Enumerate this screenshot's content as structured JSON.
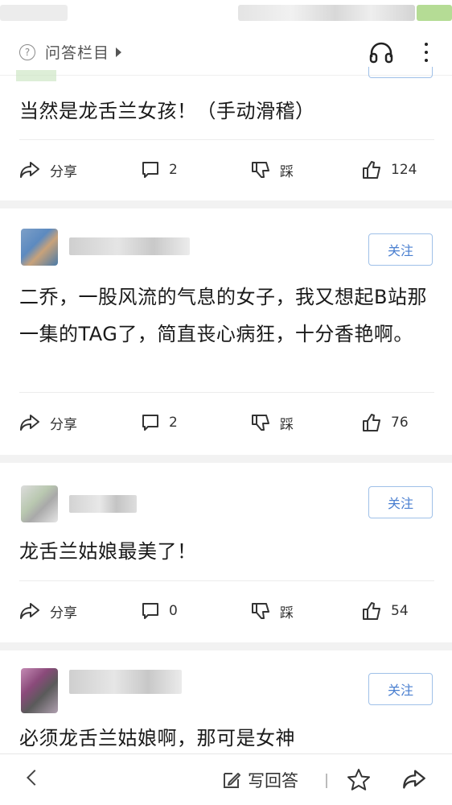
{
  "header": {
    "help_icon": "question-circle-icon",
    "title": "问答栏目",
    "headphone_icon": "headphone-icon",
    "more_icon": "more-vertical-icon"
  },
  "answers": [
    {
      "text": "当然是龙舌兰女孩！（手动滑稽）",
      "share": "分享",
      "comments": "2",
      "dislike": "踩",
      "likes": "124"
    },
    {
      "follow": "关注",
      "text": "二乔，一股风流的气息的女子，我又想起B站那一集的TAG了，简直丧心病狂，十分香艳啊。",
      "share": "分享",
      "comments": "2",
      "dislike": "踩",
      "likes": "76"
    },
    {
      "follow": "关注",
      "text": "龙舌兰姑娘最美了！",
      "share": "分享",
      "comments": "0",
      "dislike": "踩",
      "likes": "54"
    },
    {
      "follow": "关注",
      "text": "必须龙舌兰姑娘啊，那可是女神"
    }
  ],
  "bottom": {
    "back_icon": "chevron-left-icon",
    "write_label": "写回答",
    "star_icon": "star-outline-icon",
    "share_icon": "share-arrow-icon"
  },
  "colors": {
    "follow_blue": "#4a7fd0",
    "separator": "#f2f2f2"
  }
}
